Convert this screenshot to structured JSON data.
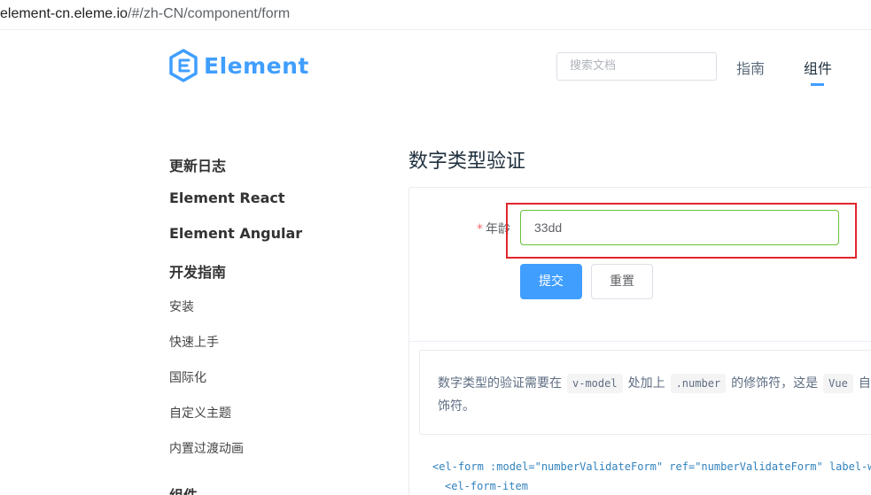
{
  "browser": {
    "url_host": "element-cn.eleme.io",
    "url_path": "/#/zh-CN/component/form"
  },
  "header": {
    "logo_text": "Element",
    "search_placeholder": "搜索文档",
    "nav": [
      "指南",
      "组件"
    ],
    "accent": "#409eff"
  },
  "sidebar": {
    "groups": [
      "更新日志",
      "Element React",
      "Element Angular",
      "开发指南"
    ],
    "items": [
      "安装",
      "快速上手",
      "国际化",
      "自定义主题",
      "内置过渡动画"
    ],
    "next_group": "组件"
  },
  "main": {
    "section_title": "数字类型验证",
    "form": {
      "required_mark": "*",
      "age_label": "年龄",
      "age_value": "33dd",
      "submit_label": "提交",
      "reset_label": "重置",
      "input_border_color": "#67c23a",
      "highlight_color": "#e0262c"
    },
    "description": {
      "part1": "数字类型的验证需要在",
      "code1": "v-model",
      "part2": "处加上",
      "code2": ".number",
      "part3": "的修饰符，这是",
      "code3": "Vue",
      "part4": "自",
      "line2": "饰符。"
    },
    "code": {
      "line1": "<el-form :model=\"numberValidateForm\" ref=\"numberValidateForm\" label-wid",
      "line2": "<el-form-item"
    }
  }
}
